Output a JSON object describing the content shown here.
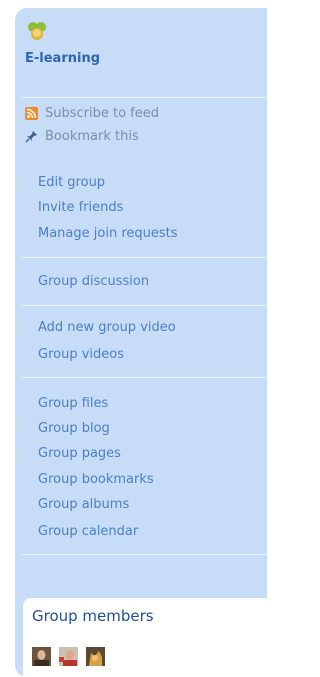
{
  "group": {
    "name": "E-learning",
    "icon": "group-icon"
  },
  "feed": {
    "subscribe_label": "Subscribe to feed",
    "bookmark_label": "Bookmark this"
  },
  "owner_menu": [
    "Edit group",
    "Invite friends",
    "Manage join requests"
  ],
  "discussion_menu": [
    "Group discussion"
  ],
  "video_menu": [
    "Add new group video",
    "Group videos"
  ],
  "content_menu": [
    "Group files",
    "Group blog",
    "Group pages",
    "Group bookmarks",
    "Group albums",
    "Group calendar"
  ],
  "members": {
    "title": "Group members",
    "avatars": [
      "member-avatar-1",
      "member-avatar-2",
      "member-avatar-3"
    ]
  },
  "colors": {
    "panel": "#c7dcf7",
    "link": "#4b7fc7",
    "title": "#2f66b3",
    "muted": "#7d8ea6"
  }
}
